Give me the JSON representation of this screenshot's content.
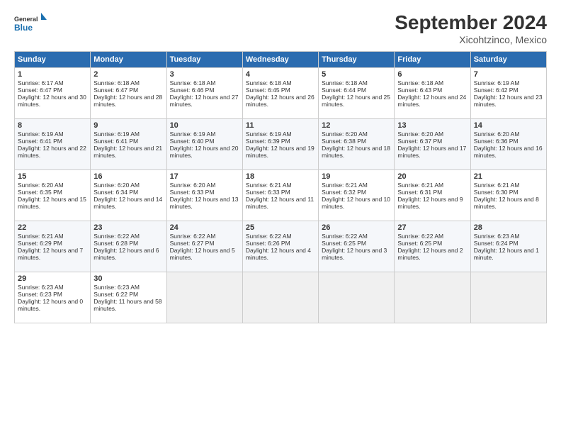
{
  "header": {
    "logo_line1": "General",
    "logo_line2": "Blue",
    "month": "September 2024",
    "location": "Xicohtzinco, Mexico"
  },
  "weekdays": [
    "Sunday",
    "Monday",
    "Tuesday",
    "Wednesday",
    "Thursday",
    "Friday",
    "Saturday"
  ],
  "weeks": [
    [
      {
        "day": "1",
        "sunrise": "6:17 AM",
        "sunset": "6:47 PM",
        "daylight": "12 hours and 30 minutes."
      },
      {
        "day": "2",
        "sunrise": "6:18 AM",
        "sunset": "6:47 PM",
        "daylight": "12 hours and 28 minutes."
      },
      {
        "day": "3",
        "sunrise": "6:18 AM",
        "sunset": "6:46 PM",
        "daylight": "12 hours and 27 minutes."
      },
      {
        "day": "4",
        "sunrise": "6:18 AM",
        "sunset": "6:45 PM",
        "daylight": "12 hours and 26 minutes."
      },
      {
        "day": "5",
        "sunrise": "6:18 AM",
        "sunset": "6:44 PM",
        "daylight": "12 hours and 25 minutes."
      },
      {
        "day": "6",
        "sunrise": "6:18 AM",
        "sunset": "6:43 PM",
        "daylight": "12 hours and 24 minutes."
      },
      {
        "day": "7",
        "sunrise": "6:19 AM",
        "sunset": "6:42 PM",
        "daylight": "12 hours and 23 minutes."
      }
    ],
    [
      {
        "day": "8",
        "sunrise": "6:19 AM",
        "sunset": "6:41 PM",
        "daylight": "12 hours and 22 minutes."
      },
      {
        "day": "9",
        "sunrise": "6:19 AM",
        "sunset": "6:41 PM",
        "daylight": "12 hours and 21 minutes."
      },
      {
        "day": "10",
        "sunrise": "6:19 AM",
        "sunset": "6:40 PM",
        "daylight": "12 hours and 20 minutes."
      },
      {
        "day": "11",
        "sunrise": "6:19 AM",
        "sunset": "6:39 PM",
        "daylight": "12 hours and 19 minutes."
      },
      {
        "day": "12",
        "sunrise": "6:20 AM",
        "sunset": "6:38 PM",
        "daylight": "12 hours and 18 minutes."
      },
      {
        "day": "13",
        "sunrise": "6:20 AM",
        "sunset": "6:37 PM",
        "daylight": "12 hours and 17 minutes."
      },
      {
        "day": "14",
        "sunrise": "6:20 AM",
        "sunset": "6:36 PM",
        "daylight": "12 hours and 16 minutes."
      }
    ],
    [
      {
        "day": "15",
        "sunrise": "6:20 AM",
        "sunset": "6:35 PM",
        "daylight": "12 hours and 15 minutes."
      },
      {
        "day": "16",
        "sunrise": "6:20 AM",
        "sunset": "6:34 PM",
        "daylight": "12 hours and 14 minutes."
      },
      {
        "day": "17",
        "sunrise": "6:20 AM",
        "sunset": "6:33 PM",
        "daylight": "12 hours and 13 minutes."
      },
      {
        "day": "18",
        "sunrise": "6:21 AM",
        "sunset": "6:33 PM",
        "daylight": "12 hours and 11 minutes."
      },
      {
        "day": "19",
        "sunrise": "6:21 AM",
        "sunset": "6:32 PM",
        "daylight": "12 hours and 10 minutes."
      },
      {
        "day": "20",
        "sunrise": "6:21 AM",
        "sunset": "6:31 PM",
        "daylight": "12 hours and 9 minutes."
      },
      {
        "day": "21",
        "sunrise": "6:21 AM",
        "sunset": "6:30 PM",
        "daylight": "12 hours and 8 minutes."
      }
    ],
    [
      {
        "day": "22",
        "sunrise": "6:21 AM",
        "sunset": "6:29 PM",
        "daylight": "12 hours and 7 minutes."
      },
      {
        "day": "23",
        "sunrise": "6:22 AM",
        "sunset": "6:28 PM",
        "daylight": "12 hours and 6 minutes."
      },
      {
        "day": "24",
        "sunrise": "6:22 AM",
        "sunset": "6:27 PM",
        "daylight": "12 hours and 5 minutes."
      },
      {
        "day": "25",
        "sunrise": "6:22 AM",
        "sunset": "6:26 PM",
        "daylight": "12 hours and 4 minutes."
      },
      {
        "day": "26",
        "sunrise": "6:22 AM",
        "sunset": "6:25 PM",
        "daylight": "12 hours and 3 minutes."
      },
      {
        "day": "27",
        "sunrise": "6:22 AM",
        "sunset": "6:25 PM",
        "daylight": "12 hours and 2 minutes."
      },
      {
        "day": "28",
        "sunrise": "6:23 AM",
        "sunset": "6:24 PM",
        "daylight": "12 hours and 1 minute."
      }
    ],
    [
      {
        "day": "29",
        "sunrise": "6:23 AM",
        "sunset": "6:23 PM",
        "daylight": "12 hours and 0 minutes."
      },
      {
        "day": "30",
        "sunrise": "6:23 AM",
        "sunset": "6:22 PM",
        "daylight": "11 hours and 58 minutes."
      },
      null,
      null,
      null,
      null,
      null
    ]
  ]
}
